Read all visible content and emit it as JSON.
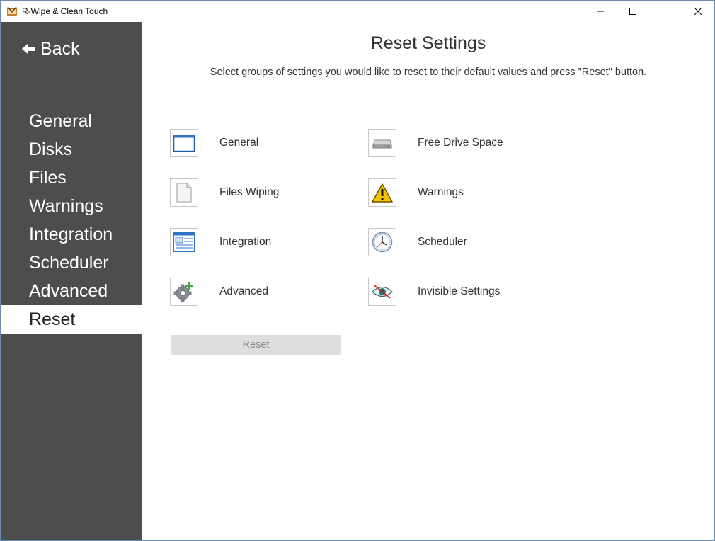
{
  "window": {
    "title": "R-Wipe & Clean Touch"
  },
  "sidebar": {
    "back_label": "Back",
    "items": [
      {
        "label": "General"
      },
      {
        "label": "Disks"
      },
      {
        "label": "Files"
      },
      {
        "label": "Warnings"
      },
      {
        "label": "Integration"
      },
      {
        "label": "Scheduler"
      },
      {
        "label": "Advanced"
      },
      {
        "label": "Reset",
        "active": true
      }
    ]
  },
  "main": {
    "title": "Reset Settings",
    "subtitle": "Select groups of settings you would like to reset to their default values and press \"Reset\" button.",
    "options": [
      {
        "label": "General",
        "icon": "window-icon"
      },
      {
        "label": "Free Drive Space",
        "icon": "drive-icon"
      },
      {
        "label": "Files Wiping",
        "icon": "file-icon"
      },
      {
        "label": "Warnings",
        "icon": "warning-icon"
      },
      {
        "label": "Integration",
        "icon": "integration-icon"
      },
      {
        "label": "Scheduler",
        "icon": "clock-icon"
      },
      {
        "label": "Advanced",
        "icon": "gear-plus-icon"
      },
      {
        "label": "Invisible Settings",
        "icon": "hidden-eye-icon"
      }
    ],
    "reset_label": "Reset"
  },
  "colors": {
    "sidebar_bg": "#4d4d4d",
    "active_item_bg": "#ffffff",
    "disabled_button_bg": "#dedede",
    "disabled_button_text": "#8c8c8c"
  }
}
